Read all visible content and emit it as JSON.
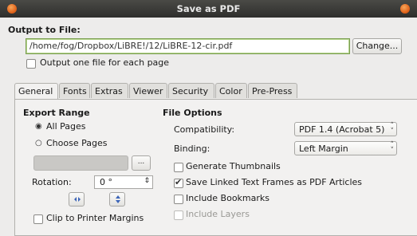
{
  "window": {
    "title": "Save as PDF"
  },
  "output": {
    "heading": "Output to File:",
    "path": "/home/fog/Dropbox/LiBRE!/12/LiBRE-12-cir.pdf",
    "change_button": "Change...",
    "one_file_per_page": "Output one file for each page"
  },
  "tabs": [
    "General",
    "Fonts",
    "Extras",
    "Viewer",
    "Security",
    "Color",
    "Pre-Press"
  ],
  "export_range": {
    "heading": "Export Range",
    "all_pages": "All Pages",
    "choose_pages": "Choose Pages",
    "pages_button": "...",
    "rotation_label": "Rotation:",
    "rotation_value": "0 °",
    "clip_label": "Clip to Printer Margins"
  },
  "file_options": {
    "heading": "File Options",
    "compat_label": "Compatibility:",
    "compat_value": "PDF 1.4 (Acrobat 5)",
    "binding_label": "Binding:",
    "binding_value": "Left Margin",
    "gen_thumbs": "Generate Thumbnails",
    "save_linked": "Save Linked Text Frames as PDF Articles",
    "include_bookmarks": "Include Bookmarks",
    "include_layers": "Include Layers"
  },
  "colors": {
    "accent_green": "#7a9e50",
    "title_orange": "#e3661d"
  }
}
